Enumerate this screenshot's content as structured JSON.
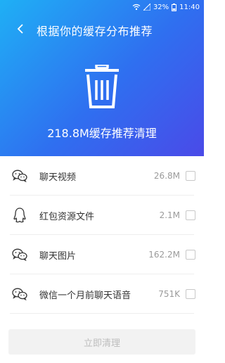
{
  "status_bar": {
    "battery": "32%",
    "time": "11:40"
  },
  "header": {
    "title": "根据你的缓存分布推荐",
    "summary": "218.8M缓存推荐清理"
  },
  "items": [
    {
      "label": "聊天视频",
      "size": "26.8M",
      "icon": "wechat-icon"
    },
    {
      "label": "红包资源文件",
      "size": "2.1M",
      "icon": "qq-penguin-icon"
    },
    {
      "label": "聊天图片",
      "size": "162.2M",
      "icon": "wechat-icon"
    },
    {
      "label": "微信一个月前聊天语音",
      "size": "751K",
      "icon": "wechat-icon"
    }
  ],
  "footer": {
    "button_label": "立即清理"
  },
  "colors": {
    "header_gradient_start": "#1fb0f5",
    "header_gradient_end": "#4a4ae8",
    "disabled_button_bg": "#f2f2f2",
    "disabled_button_text": "#bdbdbd"
  }
}
